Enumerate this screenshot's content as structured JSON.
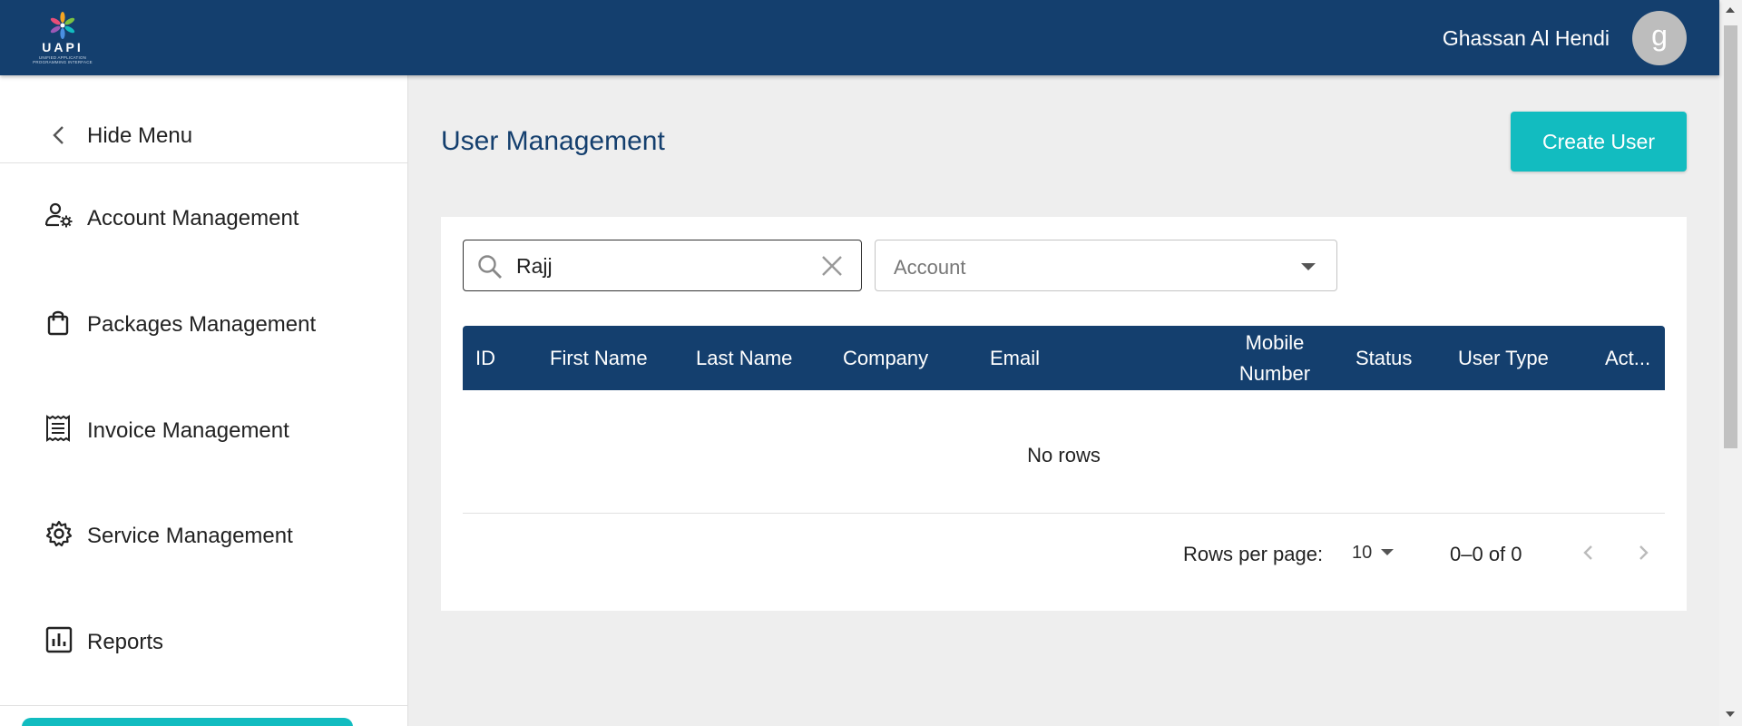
{
  "header": {
    "logo_text": "UAPI",
    "logo_subtext": "UNIFIED APPLICATION PROGRAMMING INTERFACE",
    "user_name": "Ghassan Al Hendi",
    "avatar_initial": "g",
    "background_color": "#143f6e"
  },
  "sidebar": {
    "hide_menu_label": "Hide Menu",
    "items": [
      {
        "label": "Account Management",
        "icon": "user-gear-icon"
      },
      {
        "label": "Packages Management",
        "icon": "shopping-bag-icon"
      },
      {
        "label": "Invoice Management",
        "icon": "receipt-icon"
      },
      {
        "label": "Service Management",
        "icon": "gear-icon"
      },
      {
        "label": "Reports",
        "icon": "bar-chart-icon"
      }
    ]
  },
  "main": {
    "title": "User Management",
    "create_button_label": "Create User",
    "accent_color": "#12bcc0"
  },
  "filters": {
    "search_value": "Rajj",
    "account_placeholder": "Account"
  },
  "table": {
    "columns": [
      "ID",
      "First Name",
      "Last Name",
      "Company",
      "Email",
      "Mobile Number",
      "Status",
      "User Type",
      "Act..."
    ],
    "empty_message": "No rows"
  },
  "pagination": {
    "rows_per_page_label": "Rows per page:",
    "rows_per_page_value": "10",
    "range_text": "0–0 of 0"
  }
}
